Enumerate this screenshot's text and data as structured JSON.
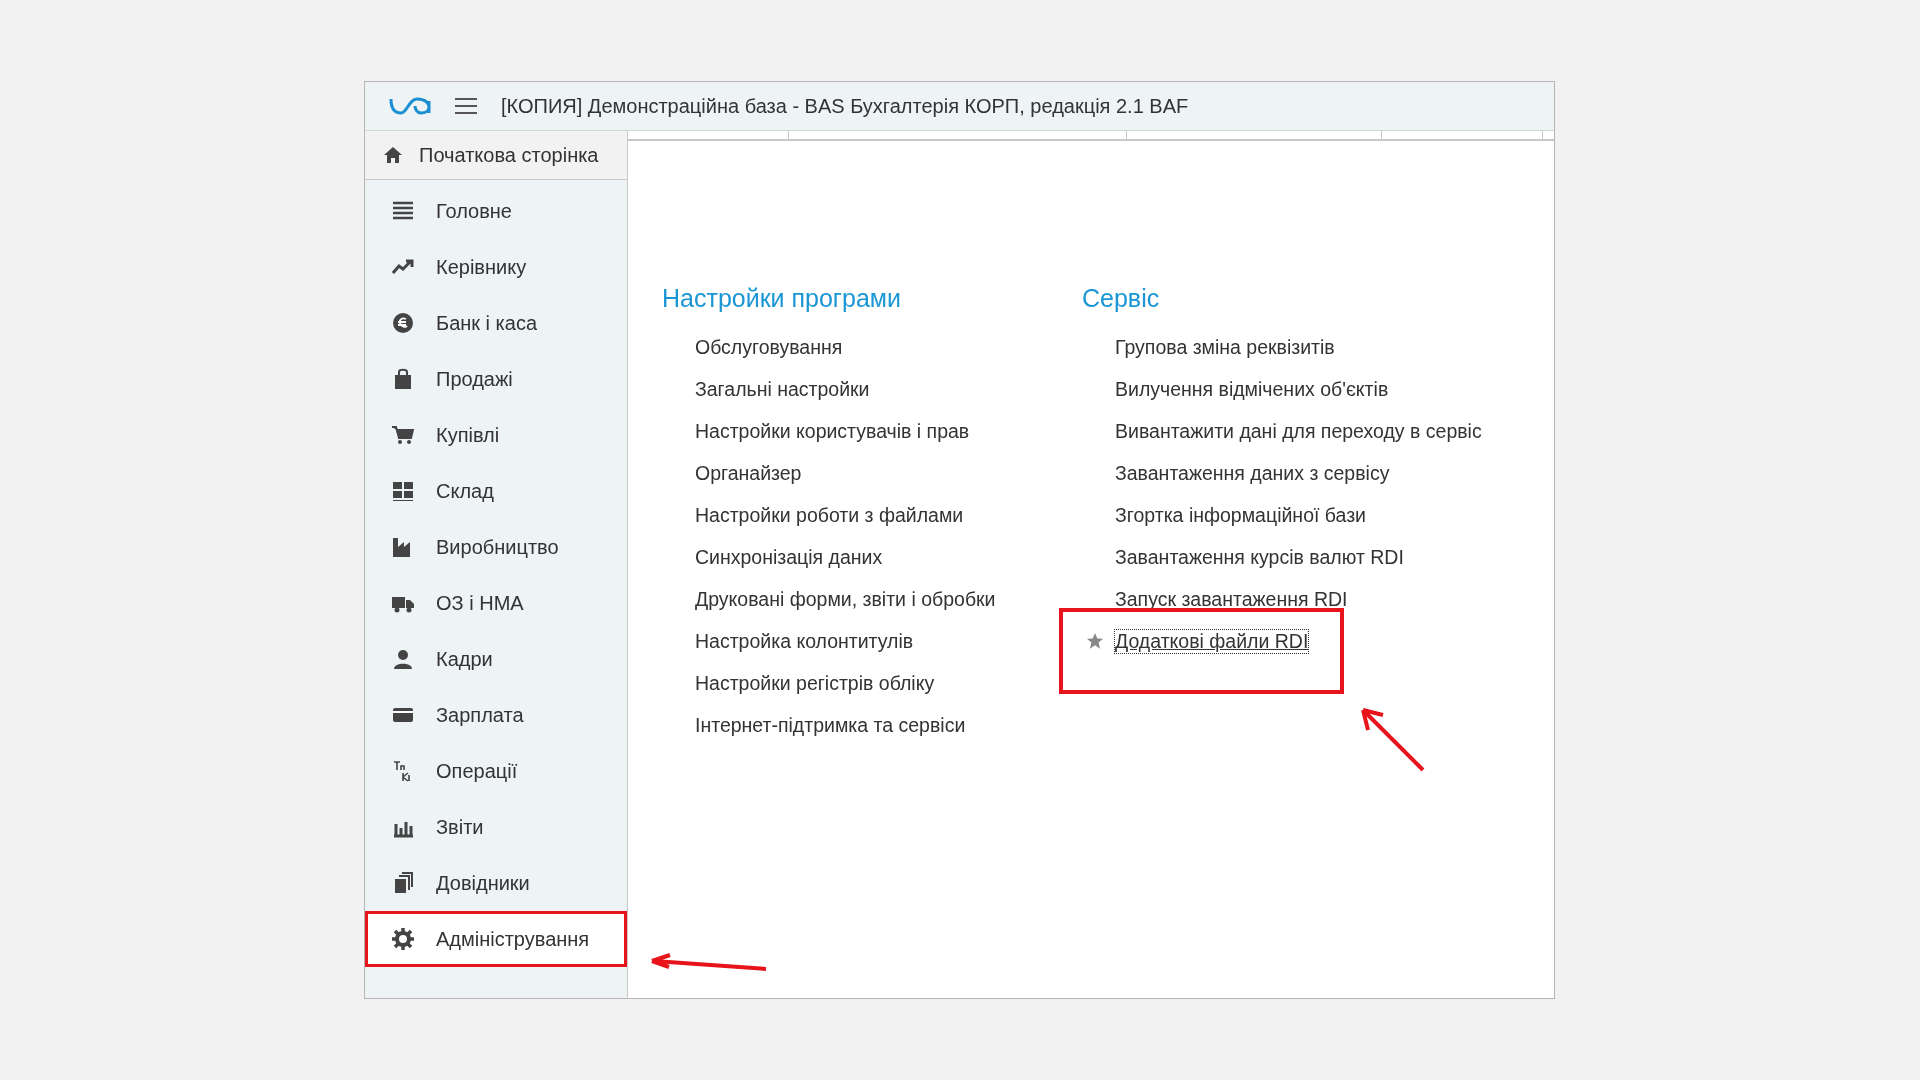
{
  "window": {
    "title": "[КОПИЯ] Демонстраційна база - BAS Бухгалтерія КОРП, редакція 2.1 BAF"
  },
  "home": {
    "label": "Початкова сторінка"
  },
  "sidebar": {
    "items": [
      {
        "label": "Головне",
        "selected": false,
        "highlighted": false
      },
      {
        "label": "Керівнику",
        "selected": false,
        "highlighted": false
      },
      {
        "label": "Банк і каса",
        "selected": false,
        "highlighted": false
      },
      {
        "label": "Продажі",
        "selected": false,
        "highlighted": false
      },
      {
        "label": "Купівлі",
        "selected": false,
        "highlighted": false
      },
      {
        "label": "Склад",
        "selected": false,
        "highlighted": false
      },
      {
        "label": "Виробництво",
        "selected": false,
        "highlighted": false
      },
      {
        "label": "ОЗ і НМА",
        "selected": false,
        "highlighted": false
      },
      {
        "label": "Кадри",
        "selected": false,
        "highlighted": false
      },
      {
        "label": "Зарплата",
        "selected": false,
        "highlighted": false
      },
      {
        "label": "Операції",
        "selected": false,
        "highlighted": false
      },
      {
        "label": "Звіти",
        "selected": false,
        "highlighted": false
      },
      {
        "label": "Довідники",
        "selected": false,
        "highlighted": false
      },
      {
        "label": "Адміністрування",
        "selected": true,
        "highlighted": true
      }
    ]
  },
  "sections": [
    {
      "title": "Настройки програми",
      "items": [
        {
          "label": "Обслуговування",
          "favorite": false,
          "focused": false,
          "highlighted": false
        },
        {
          "label": "Загальні настройки",
          "favorite": false,
          "focused": false,
          "highlighted": false
        },
        {
          "label": "Настройки користувачів і прав",
          "favorite": false,
          "focused": false,
          "highlighted": false
        },
        {
          "label": "Органайзер",
          "favorite": false,
          "focused": false,
          "highlighted": false
        },
        {
          "label": "Настройки роботи з файлами",
          "favorite": false,
          "focused": false,
          "highlighted": false
        },
        {
          "label": "Синхронізація даних",
          "favorite": false,
          "focused": false,
          "highlighted": false
        },
        {
          "label": "Друковані форми, звіти і обробки",
          "favorite": false,
          "focused": false,
          "highlighted": false
        },
        {
          "label": "Настройка колонтитулів",
          "favorite": false,
          "focused": false,
          "highlighted": false
        },
        {
          "label": "Настройки регістрів обліку",
          "favorite": false,
          "focused": false,
          "highlighted": false
        },
        {
          "label": "Інтернет-підтримка та сервіси",
          "favorite": false,
          "focused": false,
          "highlighted": false
        }
      ]
    },
    {
      "title": "Сервіс",
      "items": [
        {
          "label": "Групова зміна реквізитів",
          "favorite": false,
          "focused": false,
          "highlighted": false
        },
        {
          "label": "Вилучення відмічених об'єктів",
          "favorite": false,
          "focused": false,
          "highlighted": false
        },
        {
          "label": "Вивантажити дані для переходу в сервіс",
          "favorite": false,
          "focused": false,
          "highlighted": false
        },
        {
          "label": "Завантаження даних з сервісу",
          "favorite": false,
          "focused": false,
          "highlighted": false
        },
        {
          "label": "Згортка інформаційної бази",
          "favorite": false,
          "focused": false,
          "highlighted": false
        },
        {
          "label": "Завантаження курсів валют RDI",
          "favorite": false,
          "focused": false,
          "highlighted": false
        },
        {
          "label": "Запуск завантаження RDI",
          "favorite": false,
          "focused": false,
          "highlighted": false
        },
        {
          "label": "Додаткові файли RDI",
          "favorite": true,
          "focused": true,
          "highlighted": true
        }
      ]
    }
  ]
}
